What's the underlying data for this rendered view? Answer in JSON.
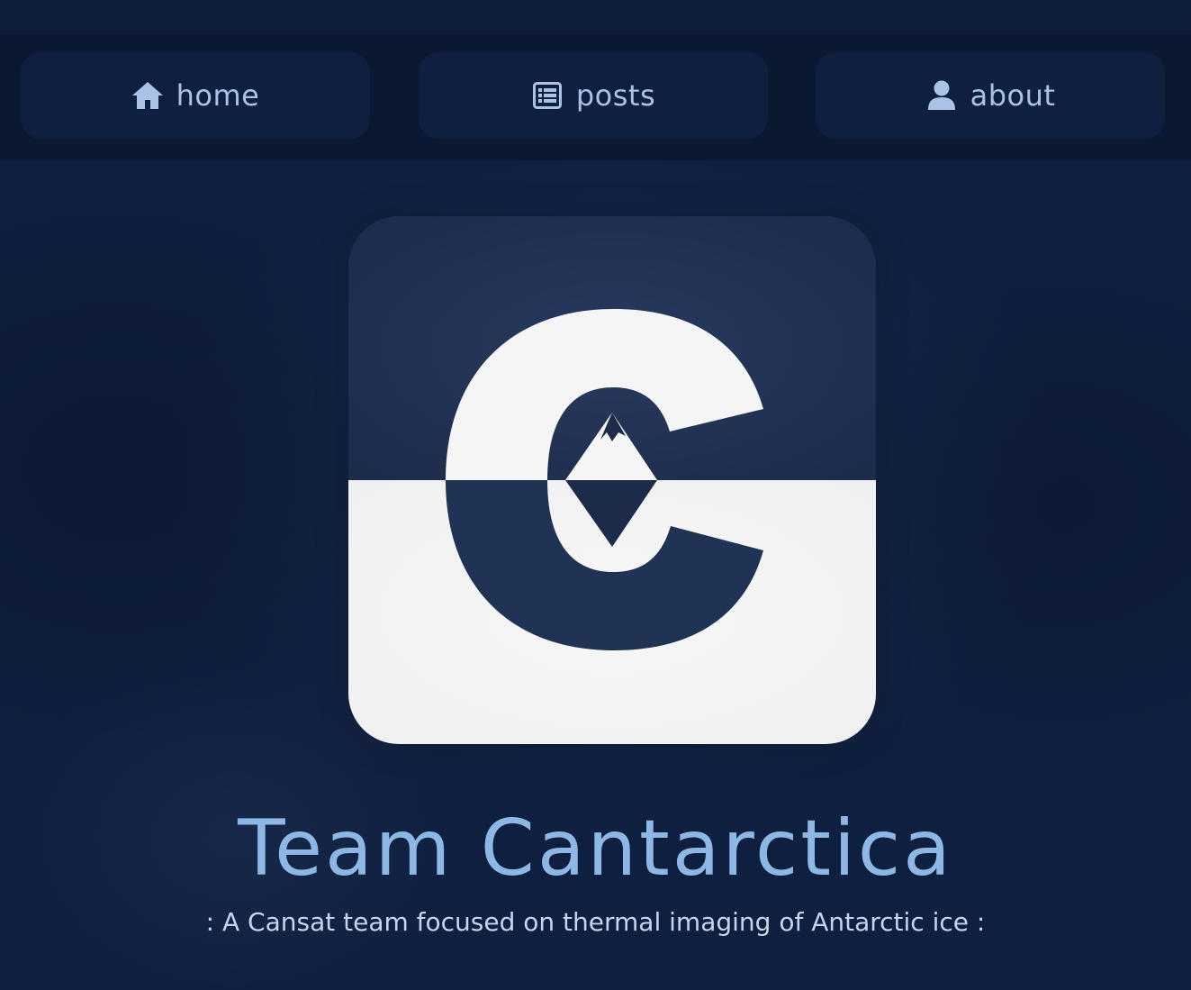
{
  "nav": {
    "items": [
      {
        "label": "home",
        "icon": "home-icon"
      },
      {
        "label": "posts",
        "icon": "list-icon"
      },
      {
        "label": "about",
        "icon": "user-icon"
      }
    ]
  },
  "hero": {
    "logo": {
      "letter": "C",
      "icon": "mountain-icon"
    },
    "title": "Team Cantarctica",
    "subtitle": ": A Cansat team focused on thermal imaging of Antarctic ice :"
  },
  "colors": {
    "background": "#0f1f3f",
    "navbar": "#0a1832",
    "nav_button": "#0e1f3f",
    "nav_text": "#a9c2e6",
    "title": "#8db8e6",
    "subtitle": "#c4d5ee",
    "logo_dark": "#1f2d4d",
    "logo_light": "#f2f2f3"
  }
}
